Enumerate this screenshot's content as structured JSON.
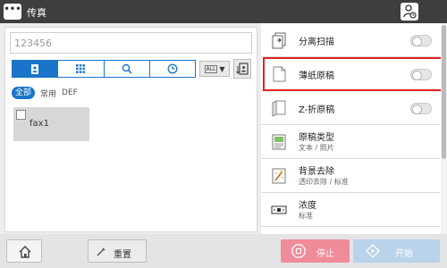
{
  "header": {
    "menu_label": "•••",
    "title": "传真",
    "user_icon": "user-status-icon"
  },
  "address": {
    "placeholder": "123456"
  },
  "address_tabs": [
    {
      "icon": "address-book-icon",
      "active": true
    },
    {
      "icon": "keypad-icon",
      "active": false
    },
    {
      "icon": "search-icon",
      "active": false
    },
    {
      "icon": "history-icon",
      "active": false
    }
  ],
  "filter": {
    "value": "ALL"
  },
  "index_tabs": [
    "全部",
    "常用",
    "DEF"
  ],
  "destinations": [
    {
      "label": "fax1",
      "checked": false
    }
  ],
  "settings": [
    {
      "label": "分离扫描",
      "icon": "separate-scan-icon",
      "toggle": false
    },
    {
      "label": "薄纸原稿",
      "icon": "thin-paper-icon",
      "toggle": false,
      "highlighted": true
    },
    {
      "label": "Z-折原稿",
      "icon": "z-fold-icon",
      "toggle": false
    },
    {
      "label": "原稿类型",
      "sub": "文本 / 照片",
      "icon": "original-type-icon"
    },
    {
      "label": "背景去除",
      "sub": "透印去除 / 标准",
      "icon": "background-removal-icon"
    },
    {
      "label": "浓度",
      "sub": "标准",
      "icon": "density-icon"
    }
  ],
  "footer": {
    "reset_label": "重置",
    "stop_label": "停止",
    "start_label": "开始"
  },
  "colors": {
    "accent": "#1a74c9",
    "stop": "#f08c99",
    "start": "#b9d3ea",
    "highlight": "#e02020"
  }
}
